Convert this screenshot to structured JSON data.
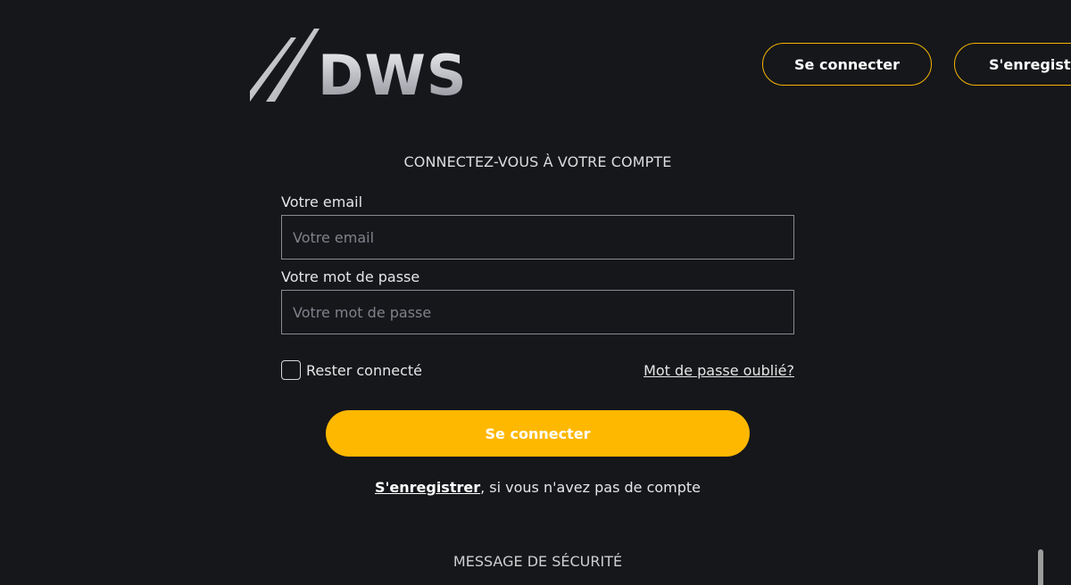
{
  "brand": {
    "logo_text": "DWS",
    "colors": {
      "background": "#16171b",
      "accent": "#ffb800",
      "outline_accent": "#f5b400"
    }
  },
  "header": {
    "login_label": "Se connecter",
    "register_label": "S'enregistrer"
  },
  "form": {
    "title": "CONNECTEZ-VOUS À VOTRE COMPTE",
    "email": {
      "label": "Votre email",
      "placeholder": "Votre email",
      "value": ""
    },
    "password": {
      "label": "Votre mot de passe",
      "placeholder": "Votre mot de passe",
      "value": ""
    },
    "remember_label": "Rester connecté",
    "remember_checked": false,
    "forgot_label": "Mot de passe oublié?",
    "submit_label": "Se connecter",
    "register_link_label": "S'enregistrer",
    "register_suffix": ", si vous n'avez pas de compte"
  },
  "security": {
    "title": "MESSAGE DE SÉCURITÉ"
  }
}
